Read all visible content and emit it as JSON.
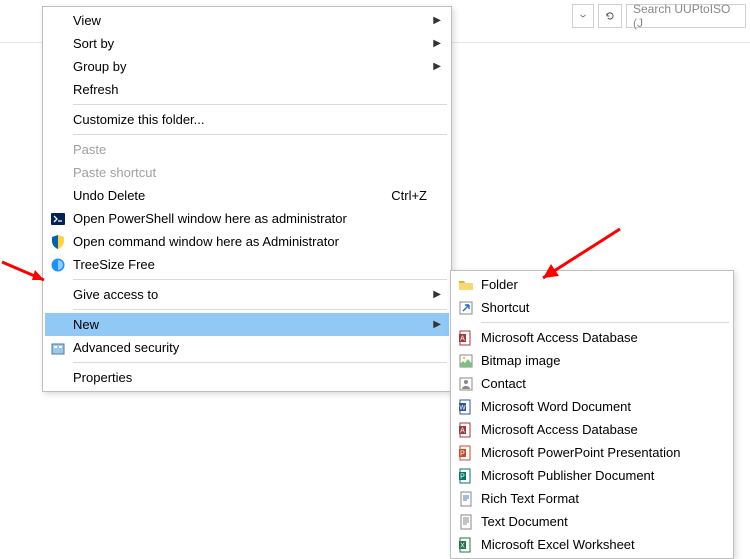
{
  "toolbar": {
    "search_placeholder": "Search UUPtoISO (J"
  },
  "menu": {
    "view": "View",
    "sort_by": "Sort by",
    "group_by": "Group by",
    "refresh": "Refresh",
    "customize": "Customize this folder...",
    "paste": "Paste",
    "paste_shortcut": "Paste shortcut",
    "undo_delete": "Undo Delete",
    "undo_delete_shortcut": "Ctrl+Z",
    "open_ps": "Open PowerShell window here as administrator",
    "open_cmd": "Open command window here as Administrator",
    "treesize": "TreeSize Free",
    "give_access": "Give access to",
    "new": "New",
    "advanced_security": "Advanced security",
    "properties": "Properties"
  },
  "submenu": {
    "folder": "Folder",
    "shortcut": "Shortcut",
    "access_db": "Microsoft Access Database",
    "bitmap": "Bitmap image",
    "contact": "Contact",
    "word": "Microsoft Word Document",
    "access_db2": "Microsoft Access Database",
    "powerpoint": "Microsoft PowerPoint Presentation",
    "publisher": "Microsoft Publisher Document",
    "rtf": "Rich Text Format",
    "text": "Text Document",
    "excel": "Microsoft Excel Worksheet"
  }
}
